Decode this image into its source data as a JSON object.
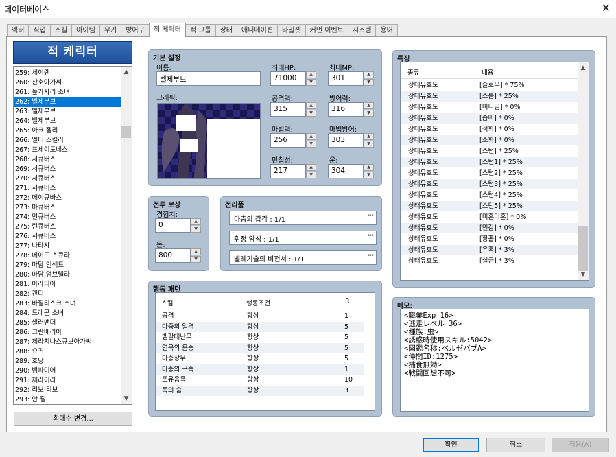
{
  "window": {
    "title": "데이터베이스",
    "close_label": "✕"
  },
  "tabs": [
    "액터",
    "직업",
    "스킬",
    "아이템",
    "무기",
    "방어구",
    "적 케릭터",
    "적 그룹",
    "상태",
    "애니메이션",
    "타일셋",
    "커먼 이벤트",
    "시스템",
    "용어"
  ],
  "active_tab": 6,
  "list": {
    "header": "적 케릭터",
    "selected_index": 3,
    "items": [
      "259: 세이렌",
      "260: 산호아가씨",
      "261: 늪가사리 소녀",
      "262: 벨제부브",
      "263: 벨제부브",
      "264: 벨제부브",
      "265: 아크 젤리",
      "266: 엘더 스킬라",
      "267: 프세이도네스",
      "268: 서큐버스",
      "269: 서큐버스",
      "270: 서큐버스",
      "271: 서큐버스",
      "272: 메이큐바스",
      "273: 마큐버스",
      "274: 민큐버스",
      "275: 린큐버스",
      "276: 서큐버스",
      "277: 나타샤",
      "278: 메이드 스큐라",
      "279: 마담 인섹트",
      "280: 마담 엄브렐라",
      "281: 아라디아",
      "282: 캔디",
      "283: 바질리스크 소녀",
      "284: 드래곤 소녀",
      "285: 샐러맨더",
      "286: 그란베리아",
      "287: 제라치나스큐브아가씨",
      "288: 요귀",
      "289: 호낭",
      "290: 뱀파이어",
      "291: 제라이라",
      "292: 리보·리보",
      "293: 안 필"
    ],
    "change_max_button": "최대수 변경..."
  },
  "basic": {
    "title": "기본 설정",
    "name_label": "이름:",
    "name_value": "벨제부브",
    "graphic_label": "그래픽:",
    "maxhp_label": "최대HP:",
    "maxhp_value": "71000",
    "maxmp_label": "최대MP:",
    "maxmp_value": "301",
    "atk_label": "공격력:",
    "atk_value": "315",
    "def_label": "방어력:",
    "def_value": "316",
    "mat_label": "마법력:",
    "mat_value": "256",
    "mdf_label": "마법방어:",
    "mdf_value": "303",
    "agi_label": "민첩성:",
    "agi_value": "217",
    "luk_label": "운:",
    "luk_value": "304"
  },
  "reward": {
    "title": "전투 보상",
    "exp_label": "경험치:",
    "exp_value": "0",
    "gold_label": "돈:",
    "gold_value": "800"
  },
  "drops": {
    "title": "전리품",
    "items": [
      "마충의 갑각 : 1/1",
      "휘정 암석 : 1/1",
      "벨레기술의 비전서 : 1/1"
    ]
  },
  "actions": {
    "title": "행동 패턴",
    "col_skill": "스킬",
    "col_cond": "행동조건",
    "col_r": "R",
    "rows": [
      {
        "skill": "공격",
        "cond": "항상",
        "r": "1"
      },
      {
        "skill": "마충의 일격",
        "cond": "항상",
        "r": "5"
      },
      {
        "skill": "벨팔대난무",
        "cond": "항상",
        "r": "5"
      },
      {
        "skill": "연옥의 음송",
        "cond": "항상",
        "r": "5"
      },
      {
        "skill": "마충장무",
        "cond": "항상",
        "r": "5"
      },
      {
        "skill": "마충의 구속",
        "cond": "항상",
        "r": "1"
      },
      {
        "skill": "포유음욕",
        "cond": "항상",
        "r": "10"
      },
      {
        "skill": "독의 숨",
        "cond": "항상",
        "r": "3"
      }
    ]
  },
  "traits": {
    "title": "특징",
    "col_type": "종류",
    "col_content": "내용",
    "rows": [
      {
        "type": "상태유효도",
        "content": "[슬로우] * 75%"
      },
      {
        "type": "상태유효도",
        "content": "[스롤] * 25%"
      },
      {
        "type": "상태유효도",
        "content": "[미니밈] * 0%"
      },
      {
        "type": "상태유효도",
        "content": "[즙비] * 0%"
      },
      {
        "type": "상태유효도",
        "content": "[석화] * 0%"
      },
      {
        "type": "상태유효도",
        "content": "[소화] * 0%"
      },
      {
        "type": "상태유효도",
        "content": "[스턴] * 25%"
      },
      {
        "type": "상태유효도",
        "content": "[스턴1] * 25%"
      },
      {
        "type": "상태유효도",
        "content": "[스턴2] * 25%"
      },
      {
        "type": "상태유효도",
        "content": "[스턴3] * 25%"
      },
      {
        "type": "상태유효도",
        "content": "[스턴4] * 25%"
      },
      {
        "type": "상태유효도",
        "content": "[스턴5] * 25%"
      },
      {
        "type": "상태유효도",
        "content": "[미혼미혼] * 0%"
      },
      {
        "type": "상태유효도",
        "content": "[민감] * 0%"
      },
      {
        "type": "상태유효도",
        "content": "[황홀] * 0%"
      },
      {
        "type": "상태유효도",
        "content": "[유혹] * 3%"
      },
      {
        "type": "상태유효도",
        "content": "[실금] * 3%"
      }
    ]
  },
  "memo": {
    "title": "메모:",
    "lines": [
      "<職業Exp 16>",
      "<逃走レベル 36>",
      "<種族:虫>",
      "<誘惑時使用スキル:5042>",
      "<図鑑名称:ベルゼバブA>",
      "<仲間ID:1275>",
      "<捕食無効>",
      "<戦闘回想不可>"
    ]
  },
  "footer": {
    "ok": "확인",
    "cancel": "취소",
    "apply": "적용(A)"
  },
  "colors": {
    "panel": "#b3c2d3",
    "list_header": "#2a5ea8",
    "selection": "#0078d7"
  }
}
